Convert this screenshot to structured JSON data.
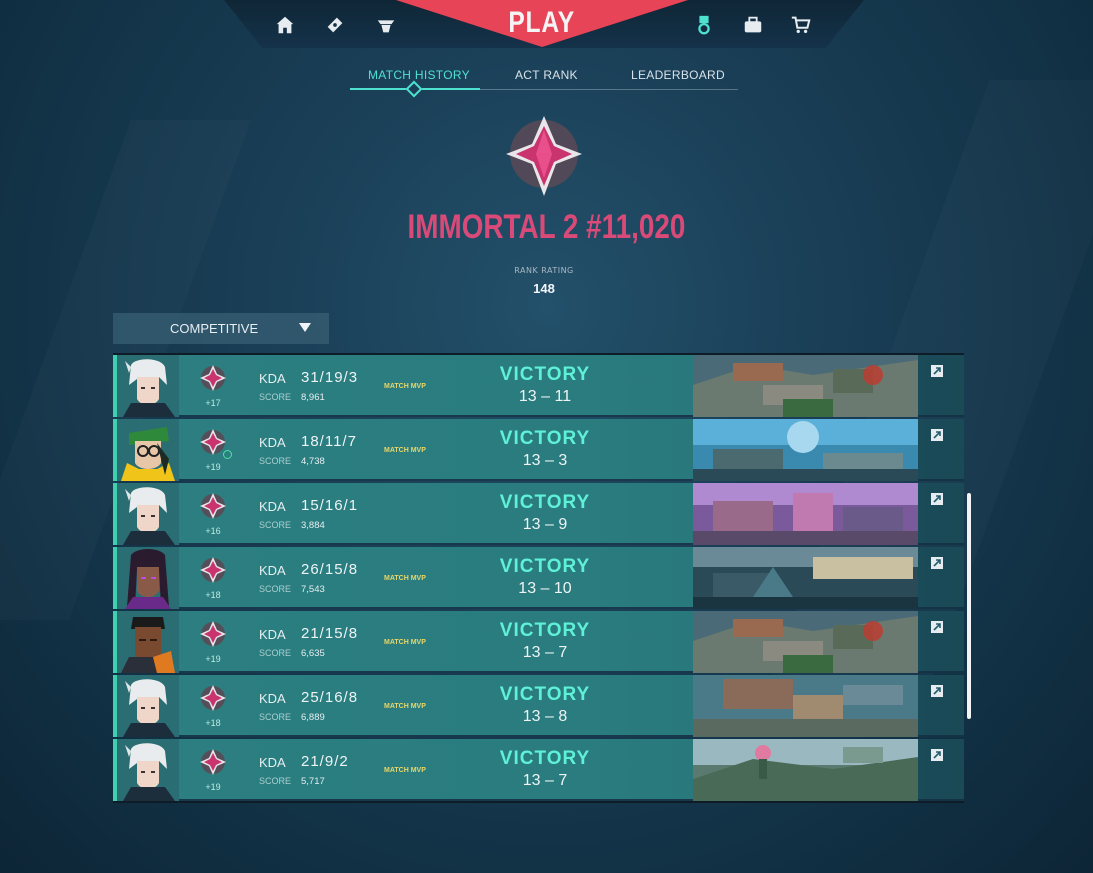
{
  "nav": {
    "play_label": "PLAY",
    "left_icons": [
      "home-icon",
      "battlepass-icon",
      "agents-icon"
    ],
    "right_icons": [
      "career-icon",
      "collection-icon",
      "store-icon"
    ]
  },
  "tabs": [
    {
      "label": "MATCH HISTORY",
      "active": true
    },
    {
      "label": "ACT RANK",
      "active": false
    },
    {
      "label": "LEADERBOARD",
      "active": false
    }
  ],
  "rank": {
    "title": "IMMORTAL 2 #11,020",
    "rating_label": "RANK RATING",
    "rating_value": "148",
    "color": "#d94a78"
  },
  "queue_select": {
    "value": "COMPETITIVE"
  },
  "matches": [
    {
      "agent": "jett",
      "rr_gain": "+17",
      "kda_label": "KDA",
      "kda": "31/19/3",
      "score_label": "SCORE",
      "score": "8,961",
      "mvp": "MATCH MVP",
      "result": "VICTORY",
      "final_score": "13 – 11",
      "map": "map-a",
      "rank_up": false
    },
    {
      "agent": "killjoy",
      "rr_gain": "+19",
      "kda_label": "KDA",
      "kda": "18/11/7",
      "score_label": "SCORE",
      "score": "4,738",
      "mvp": "MATCH MVP",
      "result": "VICTORY",
      "final_score": "13 – 3",
      "map": "map-b",
      "rank_up": true
    },
    {
      "agent": "jett",
      "rr_gain": "+16",
      "kda_label": "KDA",
      "kda": "15/16/1",
      "score_label": "SCORE",
      "score": "3,884",
      "mvp": "",
      "result": "VICTORY",
      "final_score": "13 – 9",
      "map": "map-c",
      "rank_up": false
    },
    {
      "agent": "reyna",
      "rr_gain": "+18",
      "kda_label": "KDA",
      "kda": "26/15/8",
      "score_label": "SCORE",
      "score": "7,543",
      "mvp": "MATCH MVP",
      "result": "VICTORY",
      "final_score": "13 – 10",
      "map": "map-d",
      "rank_up": false
    },
    {
      "agent": "phoenix",
      "rr_gain": "+19",
      "kda_label": "KDA",
      "kda": "21/15/8",
      "score_label": "SCORE",
      "score": "6,635",
      "mvp": "MATCH MVP",
      "result": "VICTORY",
      "final_score": "13 – 7",
      "map": "map-a",
      "rank_up": false
    },
    {
      "agent": "jett",
      "rr_gain": "+18",
      "kda_label": "KDA",
      "kda": "25/16/8",
      "score_label": "SCORE",
      "score": "6,889",
      "mvp": "MATCH MVP",
      "result": "VICTORY",
      "final_score": "13 – 8",
      "map": "map-e",
      "rank_up": false
    },
    {
      "agent": "jett",
      "rr_gain": "+19",
      "kda_label": "KDA",
      "kda": "21/9/2",
      "score_label": "SCORE",
      "score": "5,717",
      "mvp": "MATCH MVP",
      "result": "VICTORY",
      "final_score": "13 – 7",
      "map": "map-f",
      "rank_up": false
    }
  ],
  "colors": {
    "victory": "#5ff1d7",
    "mvp": "#e8d66a",
    "accent": "#4fe1d0",
    "play": "#e84457"
  }
}
